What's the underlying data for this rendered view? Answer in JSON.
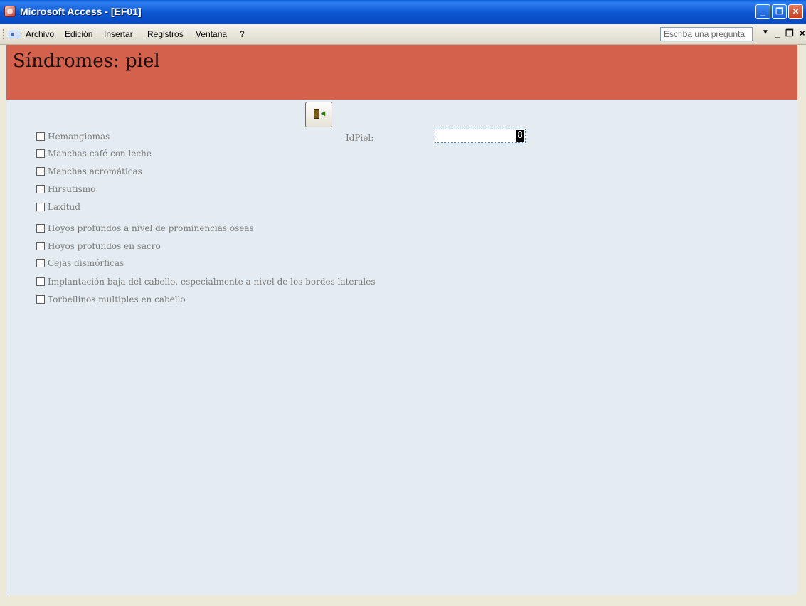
{
  "window": {
    "title": "Microsoft Access - [EF01]"
  },
  "menu": {
    "items": [
      "Archivo",
      "Edición",
      "Insertar",
      "Registros",
      "Ventana",
      "?"
    ],
    "help_placeholder": "Escriba una pregunta"
  },
  "form": {
    "title": "Síndromes: piel",
    "id_label": "IdPiel:",
    "id_value": "8",
    "checkboxes": [
      "Hemangiomas",
      "Manchas café con leche",
      "Manchas acromáticas",
      "Hirsutismo",
      "Laxitud",
      "Hoyos profundos a nivel de prominencias óseas",
      "Hoyos profundos en sacro",
      "Cejas dismórficas",
      "Implantación baja del cabello, especialmente a nivel de los bordes laterales",
      "Torbellinos multiples en cabello"
    ]
  }
}
